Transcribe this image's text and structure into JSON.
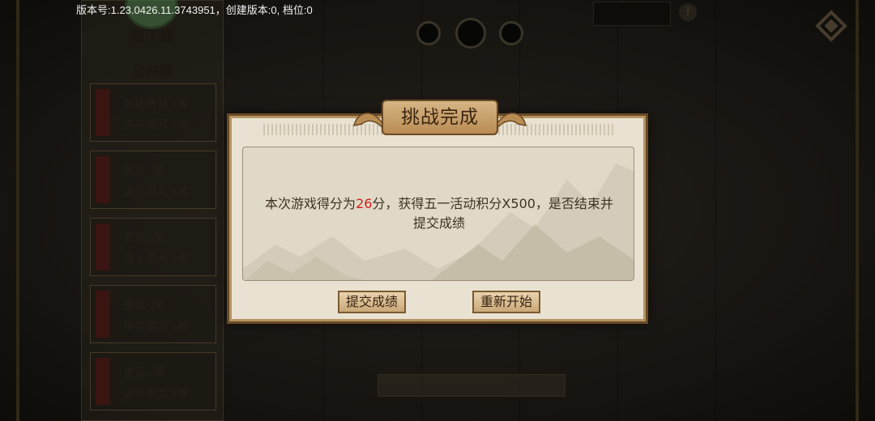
{
  "status": {
    "version_text": "版本号:1.23.0426.11.3743951，创建版本:0, 档位:0"
  },
  "left_panel": {
    "title": "弦下悬",
    "total": "总26筹",
    "rules": [
      {
        "line1": "有初贯耳 3筹",
        "line2": "连中贯耳 3筹"
      },
      {
        "line1": "贯耳 2筹",
        "line2": "连中贯耳 3筹"
      },
      {
        "line1": "贯耳 2筹",
        "line2": "连中贯耳 3筹"
      },
      {
        "line1": "贯耳 2筹",
        "line2": "连中贯耳 3筹"
      },
      {
        "line1": "贯耳 2筹",
        "line2": "连中贯耳 3筹"
      }
    ]
  },
  "dialog": {
    "title": "挑战完成",
    "message_prefix": "本次游戏得分为",
    "score": "26",
    "message_suffix": "分，获得五一活动积分X500，是否结束并提交成绩",
    "submit_label": "提交成绩",
    "restart_label": "重新开始"
  },
  "colors": {
    "accent": "#d21f1f",
    "frame": "#6a4a25",
    "parchment": "#e9e2d2"
  },
  "icons": [
    "dragon-icon",
    "knot-icon",
    "exclamation-icon"
  ]
}
